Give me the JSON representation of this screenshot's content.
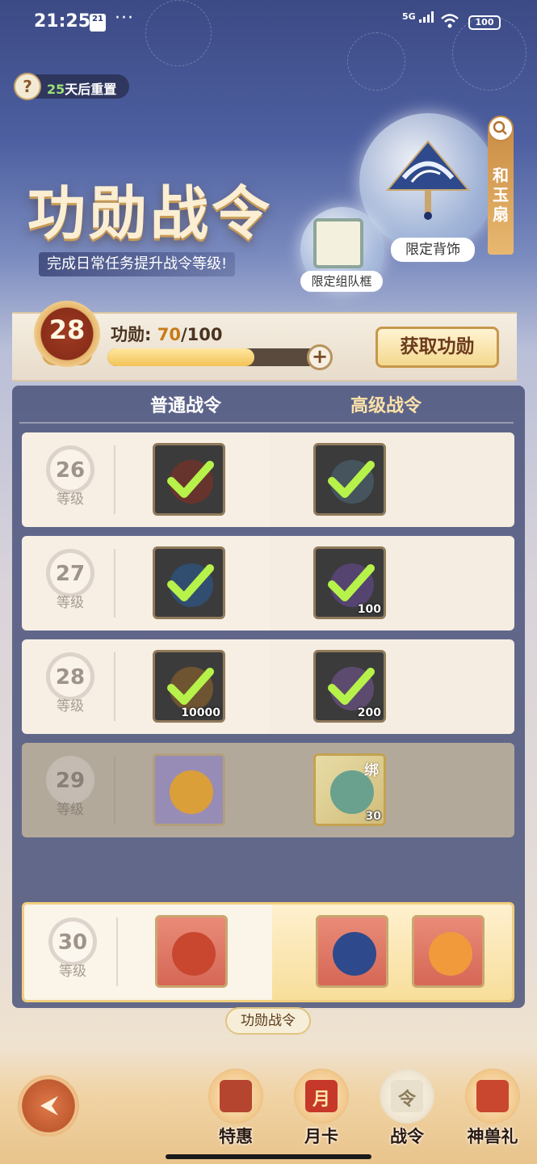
{
  "status_bar": {
    "time": "21:25",
    "calendar_day": "21",
    "dots": "···",
    "network": "5G",
    "battery": "100"
  },
  "header": {
    "reset_days": "25",
    "reset_suffix": "天后重置",
    "title": "功勋战令",
    "subtitle": "完成日常任务提升战令等级!",
    "help_icon": "?",
    "reward_back_tag": "限定背饰",
    "reward_frame_tag": "限定组队框",
    "side_banner_text": "和玉扇"
  },
  "level": {
    "current_level": "28",
    "merit_label": "功勋:",
    "merit_current": "70",
    "merit_total": "/100",
    "progress_fraction": 0.7,
    "plus_symbol": "+",
    "get_merit_button": "获取功勋"
  },
  "table": {
    "col_normal": "普通战令",
    "col_premium": "高级战令",
    "level_word": "等级",
    "rows": [
      {
        "level": "26",
        "state": "claimed",
        "normal": [
          {
            "icon": "red-gem-icon",
            "qty": "",
            "style": "claimed"
          }
        ],
        "premium": [
          {
            "icon": "chest-icon",
            "qty": "",
            "style": "claimed"
          }
        ]
      },
      {
        "level": "27",
        "state": "claimed",
        "normal": [
          {
            "icon": "blue-orb-icon",
            "qty": "",
            "style": "claimed"
          }
        ],
        "premium": [
          {
            "icon": "purple-crystal-icon",
            "qty": "100",
            "style": "claimed"
          }
        ]
      },
      {
        "level": "28",
        "state": "claimed",
        "normal": [
          {
            "icon": "coin-icon",
            "qty": "10000",
            "style": "claimed"
          }
        ],
        "premium": [
          {
            "icon": "purple-flower-icon",
            "qty": "200",
            "style": "claimed"
          }
        ]
      },
      {
        "level": "29",
        "state": "locked",
        "normal": [
          {
            "icon": "gold-ingots-icon",
            "qty": "",
            "style": "purple"
          }
        ],
        "premium": [
          {
            "icon": "jade-cloud-icon",
            "qty": "30",
            "bind": "绑",
            "style": "gold"
          }
        ]
      },
      {
        "level": "30",
        "state": "current",
        "normal": [
          {
            "icon": "gem-chest-icon",
            "qty": "",
            "style": "red"
          }
        ],
        "premium": [
          {
            "icon": "blue-fan-icon",
            "qty": "",
            "style": "red"
          },
          {
            "icon": "paw-orb-icon",
            "qty": "",
            "style": "red"
          }
        ]
      }
    ]
  },
  "pass_label": "功勋战令",
  "bottom_nav": [
    {
      "label": "特惠",
      "icon": "gift-box-icon"
    },
    {
      "label": "月卡",
      "icon": "month-card-icon",
      "glyph": "月"
    },
    {
      "label": "战令",
      "icon": "battle-pass-icon",
      "glyph": "令",
      "active": true
    },
    {
      "label": "神兽礼",
      "icon": "beast-gift-icon"
    }
  ]
}
